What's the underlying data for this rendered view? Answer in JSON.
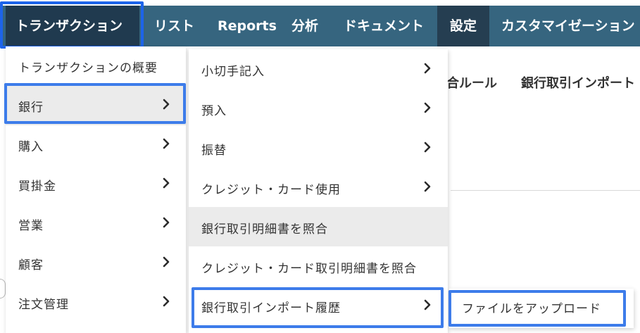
{
  "nav": {
    "tabs": [
      {
        "label": "トランザクション"
      },
      {
        "label": "リスト"
      },
      {
        "label": "Reports"
      },
      {
        "label": "分析"
      },
      {
        "label": "ドキュメント"
      },
      {
        "label": "設定"
      },
      {
        "label": "カスタマイゼーション"
      }
    ]
  },
  "background": {
    "tabs": [
      "合ルール",
      "銀行取引インポート"
    ]
  },
  "menu1": {
    "items": [
      {
        "label": "トランザクションの概要",
        "icon": "none"
      },
      {
        "label": "銀行",
        "icon": "chevron-right-icon"
      },
      {
        "label": "購入",
        "icon": "chevron-right-icon"
      },
      {
        "label": "買掛金",
        "icon": "chevron-right-icon"
      },
      {
        "label": "営業",
        "icon": "chevron-right-icon"
      },
      {
        "label": "顧客",
        "icon": "chevron-right-icon"
      },
      {
        "label": "注文管理",
        "icon": "chevron-right-icon"
      }
    ]
  },
  "menu2": {
    "items": [
      {
        "label": "小切手記入",
        "icon": "chevron-right-icon"
      },
      {
        "label": "預入",
        "icon": "chevron-right-icon"
      },
      {
        "label": "振替",
        "icon": "chevron-right-icon"
      },
      {
        "label": "クレジット・カード使用",
        "icon": "chevron-right-icon"
      },
      {
        "label": "銀行取引明細書を照合",
        "icon": "none"
      },
      {
        "label": "クレジット・カード取引明細書を照合",
        "icon": "none"
      },
      {
        "label": "銀行取引インポート履歴",
        "icon": "chevron-right-icon"
      }
    ]
  },
  "menu3": {
    "items": [
      {
        "label": "ファイルをアップロード"
      }
    ]
  },
  "colors": {
    "nav_bg": "#36657f",
    "nav_active": "#203a4f",
    "highlight": "#3d7cea",
    "hover_bg": "#ebebeb"
  }
}
